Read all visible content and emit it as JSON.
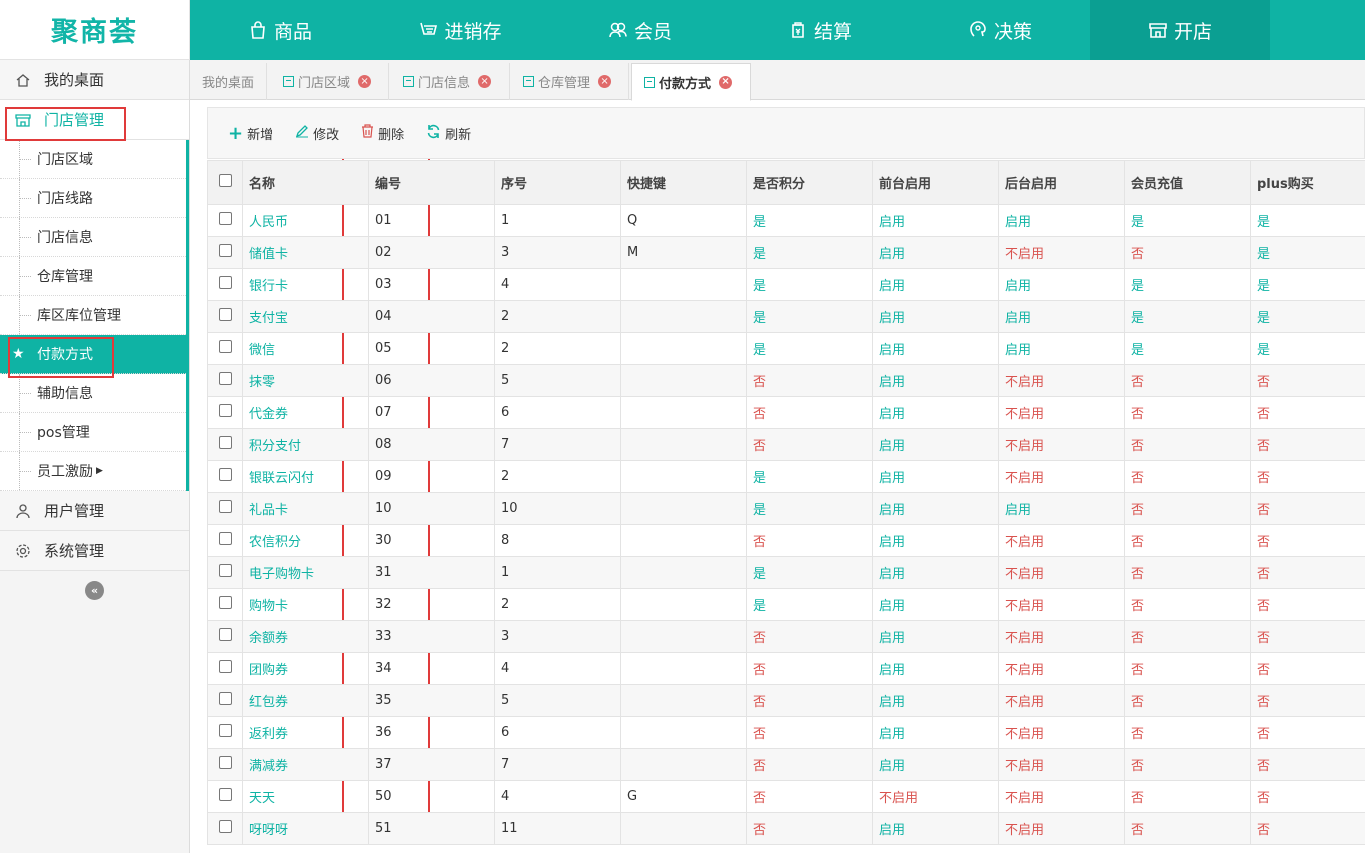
{
  "brand": {
    "logo_text": "聚商荟"
  },
  "top_nav": [
    {
      "label": "商品",
      "icon": "bag-icon"
    },
    {
      "label": "进销存",
      "icon": "stock-icon"
    },
    {
      "label": "会员",
      "icon": "members-icon"
    },
    {
      "label": "结算",
      "icon": "settlement-icon"
    },
    {
      "label": "决策",
      "icon": "decision-icon"
    },
    {
      "label": "开店",
      "icon": "store-icon",
      "active": true
    }
  ],
  "sidebar": {
    "groups": [
      {
        "label": "我的桌面",
        "icon": "home-icon"
      },
      {
        "label": "门店管理",
        "icon": "store-icon",
        "open": true
      },
      {
        "label": "用户管理",
        "icon": "user-icon"
      },
      {
        "label": "系统管理",
        "icon": "gear-icon"
      }
    ],
    "store_items": [
      "门店区域",
      "门店线路",
      "门店信息",
      "仓库管理",
      "库区库位管理",
      "付款方式",
      "辅助信息",
      "pos管理",
      "员工激励"
    ],
    "active_item": "付款方式",
    "collapse_icon": "double-chevron-left-icon"
  },
  "tabs": [
    {
      "label": "我的桌面",
      "closable": false
    },
    {
      "label": "门店区域",
      "closable": true
    },
    {
      "label": "门店信息",
      "closable": true
    },
    {
      "label": "仓库管理",
      "closable": true
    },
    {
      "label": "付款方式",
      "closable": true,
      "active": true
    }
  ],
  "toolbar": {
    "add": "新增",
    "edit": "修改",
    "delete": "删除",
    "refresh": "刷新"
  },
  "table": {
    "columns": [
      "名称",
      "编号",
      "序号",
      "快捷键",
      "是否积分",
      "前台启用",
      "后台启用",
      "会员充值",
      "plus购买"
    ],
    "rows": [
      [
        "人民币",
        "01",
        "1",
        "Q",
        "是",
        "启用",
        "启用",
        "是",
        "是"
      ],
      [
        "储值卡",
        "02",
        "3",
        "M",
        "是",
        "启用",
        "不启用",
        "否",
        "是"
      ],
      [
        "银行卡",
        "03",
        "4",
        "",
        "是",
        "启用",
        "启用",
        "是",
        "是"
      ],
      [
        "支付宝",
        "04",
        "2",
        "",
        "是",
        "启用",
        "启用",
        "是",
        "是"
      ],
      [
        "微信",
        "05",
        "2",
        "",
        "是",
        "启用",
        "启用",
        "是",
        "是"
      ],
      [
        "抹零",
        "06",
        "5",
        "",
        "否",
        "启用",
        "不启用",
        "否",
        "否"
      ],
      [
        "代金券",
        "07",
        "6",
        "",
        "否",
        "启用",
        "不启用",
        "否",
        "否"
      ],
      [
        "积分支付",
        "08",
        "7",
        "",
        "否",
        "启用",
        "不启用",
        "否",
        "否"
      ],
      [
        "银联云闪付",
        "09",
        "2",
        "",
        "是",
        "启用",
        "不启用",
        "否",
        "否"
      ],
      [
        "礼品卡",
        "10",
        "10",
        "",
        "是",
        "启用",
        "启用",
        "否",
        "否"
      ],
      [
        "农信积分",
        "30",
        "8",
        "",
        "否",
        "启用",
        "不启用",
        "否",
        "否"
      ],
      [
        "电子购物卡",
        "31",
        "1",
        "",
        "是",
        "启用",
        "不启用",
        "否",
        "否"
      ],
      [
        "购物卡",
        "32",
        "2",
        "",
        "是",
        "启用",
        "不启用",
        "否",
        "否"
      ],
      [
        "余额券",
        "33",
        "3",
        "",
        "否",
        "启用",
        "不启用",
        "否",
        "否"
      ],
      [
        "团购券",
        "34",
        "4",
        "",
        "否",
        "启用",
        "不启用",
        "否",
        "否"
      ],
      [
        "红包券",
        "35",
        "5",
        "",
        "否",
        "启用",
        "不启用",
        "否",
        "否"
      ],
      [
        "返利券",
        "36",
        "6",
        "",
        "否",
        "启用",
        "不启用",
        "否",
        "否"
      ],
      [
        "满减券",
        "37",
        "7",
        "",
        "否",
        "启用",
        "不启用",
        "否",
        "否"
      ],
      [
        "天天",
        "50",
        "4",
        "G",
        "否",
        "不启用",
        "不启用",
        "否",
        "否"
      ],
      [
        "呀呀呀",
        "51",
        "11",
        "",
        "否",
        "启用",
        "不启用",
        "否",
        "否"
      ]
    ]
  },
  "colors": {
    "brand": "#0fb3a4",
    "brand_dark": "#0b9f92",
    "negative": "#d9534f",
    "highlight_box": "#e03a3a"
  }
}
